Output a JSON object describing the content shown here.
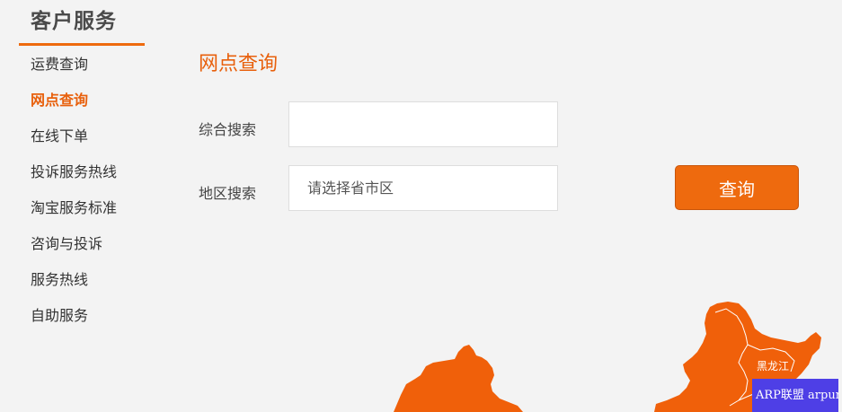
{
  "sidebar": {
    "title": "客户服务",
    "items": [
      {
        "label": "运费查询"
      },
      {
        "label": "网点查询"
      },
      {
        "label": "在线下单"
      },
      {
        "label": "投诉服务热线"
      },
      {
        "label": "淘宝服务标准"
      },
      {
        "label": "咨询与投诉"
      },
      {
        "label": "服务热线"
      },
      {
        "label": "自助服务"
      }
    ],
    "active_item": "网点查询"
  },
  "main": {
    "section_title": "网点查询",
    "search_label": "综合搜索",
    "search_value": "",
    "region_label": "地区搜索",
    "region_placeholder": "请选择省市区",
    "query_button": "查询"
  },
  "map": {
    "province_label": "黑龙江",
    "watermark": "ARP联盟 arpun.com"
  },
  "colors": {
    "accent": "#ee6a0e",
    "map_fill": "#f0600a",
    "background": "#f3f3f3"
  }
}
